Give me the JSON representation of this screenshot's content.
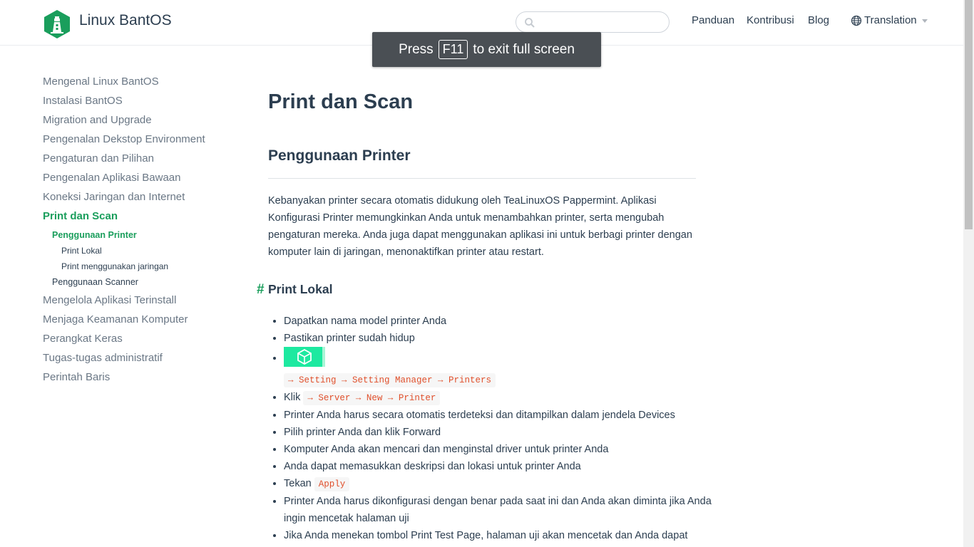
{
  "header": {
    "site_name": "Linux BantOS",
    "search_placeholder": "",
    "nav": [
      "Panduan",
      "Kontribusi",
      "Blog"
    ],
    "translation_label": "Translation"
  },
  "fullscreen_banner": {
    "before": "Press",
    "key": "F11",
    "after": "to exit full screen"
  },
  "sidebar": {
    "items_top": [
      "Mengenal Linux BantOS",
      "Instalasi BantOS",
      "Migration and Upgrade",
      "Pengenalan Dekstop Environment",
      "Pengaturan dan Pilihan",
      "Pengenalan Aplikasi Bawaan",
      "Koneksi Jaringan dan Internet"
    ],
    "active_item": "Print dan Scan",
    "sub_active": "Penggunaan Printer",
    "sub_sub": [
      "Print Lokal",
      "Print menggunakan jaringan"
    ],
    "sub_other": "Penggunaan Scanner",
    "items_bottom": [
      "Mengelola Aplikasi Terinstall",
      "Menjaga Keamanan Komputer",
      "Perangkat Keras",
      "Tugas-tugas administratif",
      "Perintah Baris"
    ]
  },
  "content": {
    "title": "Print dan Scan",
    "section_title": "Penggunaan Printer",
    "intro": "Kebanyakan printer secara otomatis didukung oleh TeaLinuxOS Pappermint. Aplikasi Konfigurasi Printer memungkinkan Anda untuk menambahkan printer, serta mengubah pengaturan mereka. Anda juga dapat menggunakan aplikasi ini untuk berbagi printer dengan komputer lain di jaringan, menonaktifkan printer atau restart.",
    "anchor": "#",
    "subsection_title": "Print Lokal",
    "steps": {
      "s1": "Dapatkan nama model printer Anda",
      "s2": "Pastikan printer sudah hidup",
      "s3_code": "→ Setting → Setting Manager → Printers",
      "s4_text": "Klik",
      "s4_code": "→ Server → New → Printer",
      "s5": "Printer Anda harus secara otomatis terdeteksi dan ditampilkan dalam jendela Devices",
      "s6": "Pilih printer Anda dan klik Forward",
      "s7": "Komputer Anda akan mencari dan menginstal driver untuk printer Anda",
      "s8": "Anda dapat memasukkan deskripsi dan lokasi untuk printer Anda",
      "s9_text": "Tekan",
      "s9_code": "Apply",
      "s10": "Printer Anda harus dikonfigurasi dengan benar pada saat ini dan Anda akan diminta jika Anda ingin mencetak halaman uji",
      "s11": "Jika Anda menekan tombol Print Test Page, halaman uji akan mencetak dan Anda dapat"
    }
  },
  "colors": {
    "accent": "#1a9e5c",
    "text": "#2c3e50",
    "code": "#e0502c",
    "badge": "#1de9a0",
    "banner": "#4a4f54"
  }
}
